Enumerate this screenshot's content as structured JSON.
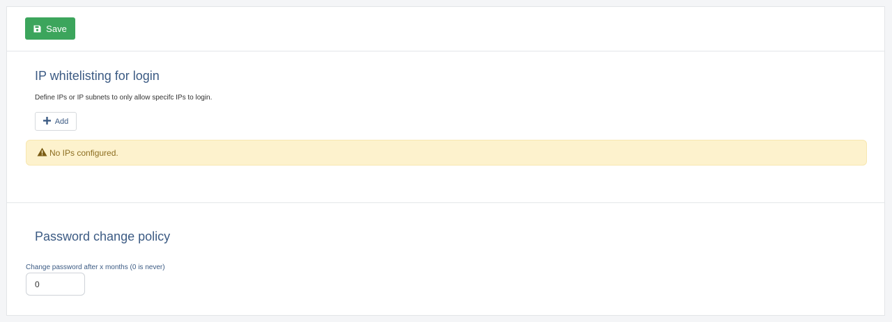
{
  "toolbar": {
    "save_label": "Save",
    "save_icon": "floppy-disk-icon",
    "save_color": "#3ca55c"
  },
  "ip_whitelist": {
    "title": "IP whitelisting for login",
    "description": "Define IPs or IP subnets to only allow specifc IPs to login.",
    "add_label": "Add",
    "add_icon": "plus-icon",
    "alert_icon": "warning-icon",
    "alert_text": "No IPs configured.",
    "alert_color": "#fdf2cd"
  },
  "password_policy": {
    "title": "Password change policy",
    "field_label": "Change password after x months (0 is never)",
    "field_value": "0"
  },
  "colors": {
    "heading": "#3b5a83",
    "alert_text": "#8c6d1f"
  }
}
